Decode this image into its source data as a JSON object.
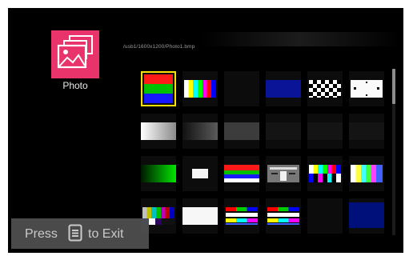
{
  "app": {
    "source_label": "Photo",
    "source_icon": "photo-gallery-icon",
    "accent_color": "#e8336b"
  },
  "browser": {
    "current_path": "/usb1/1600x1200/Photo1.bmp",
    "selected_index": 0
  },
  "exit_hint": {
    "press_text": "Press",
    "key_icon": "menu-key-icon",
    "action_text": "to Exit"
  },
  "thumbnails": [
    {
      "pattern": "rgb-horizontal-bars"
    },
    {
      "pattern": "color-bars-grid"
    },
    {
      "pattern": "black"
    },
    {
      "pattern": "solid-blue"
    },
    {
      "pattern": "checkerboard"
    },
    {
      "pattern": "white-with-dots"
    },
    {
      "pattern": "white-gray-gradient"
    },
    {
      "pattern": "gray-gradient"
    },
    {
      "pattern": "dark-gray"
    },
    {
      "pattern": "near-black"
    },
    {
      "pattern": "near-black"
    },
    {
      "pattern": "near-black"
    },
    {
      "pattern": "green-gradient"
    },
    {
      "pattern": "white-window"
    },
    {
      "pattern": "rgb-bars-with-white"
    },
    {
      "pattern": "test-chart"
    },
    {
      "pattern": "color-bars-squares"
    },
    {
      "pattern": "color-bars-bright"
    },
    {
      "pattern": "smpte-bars"
    },
    {
      "pattern": "white-frame"
    },
    {
      "pattern": "color-bars-split"
    },
    {
      "pattern": "color-bars-split"
    },
    {
      "pattern": "black"
    },
    {
      "pattern": "solid-navy"
    }
  ],
  "scroll": {
    "position": 0.0
  }
}
